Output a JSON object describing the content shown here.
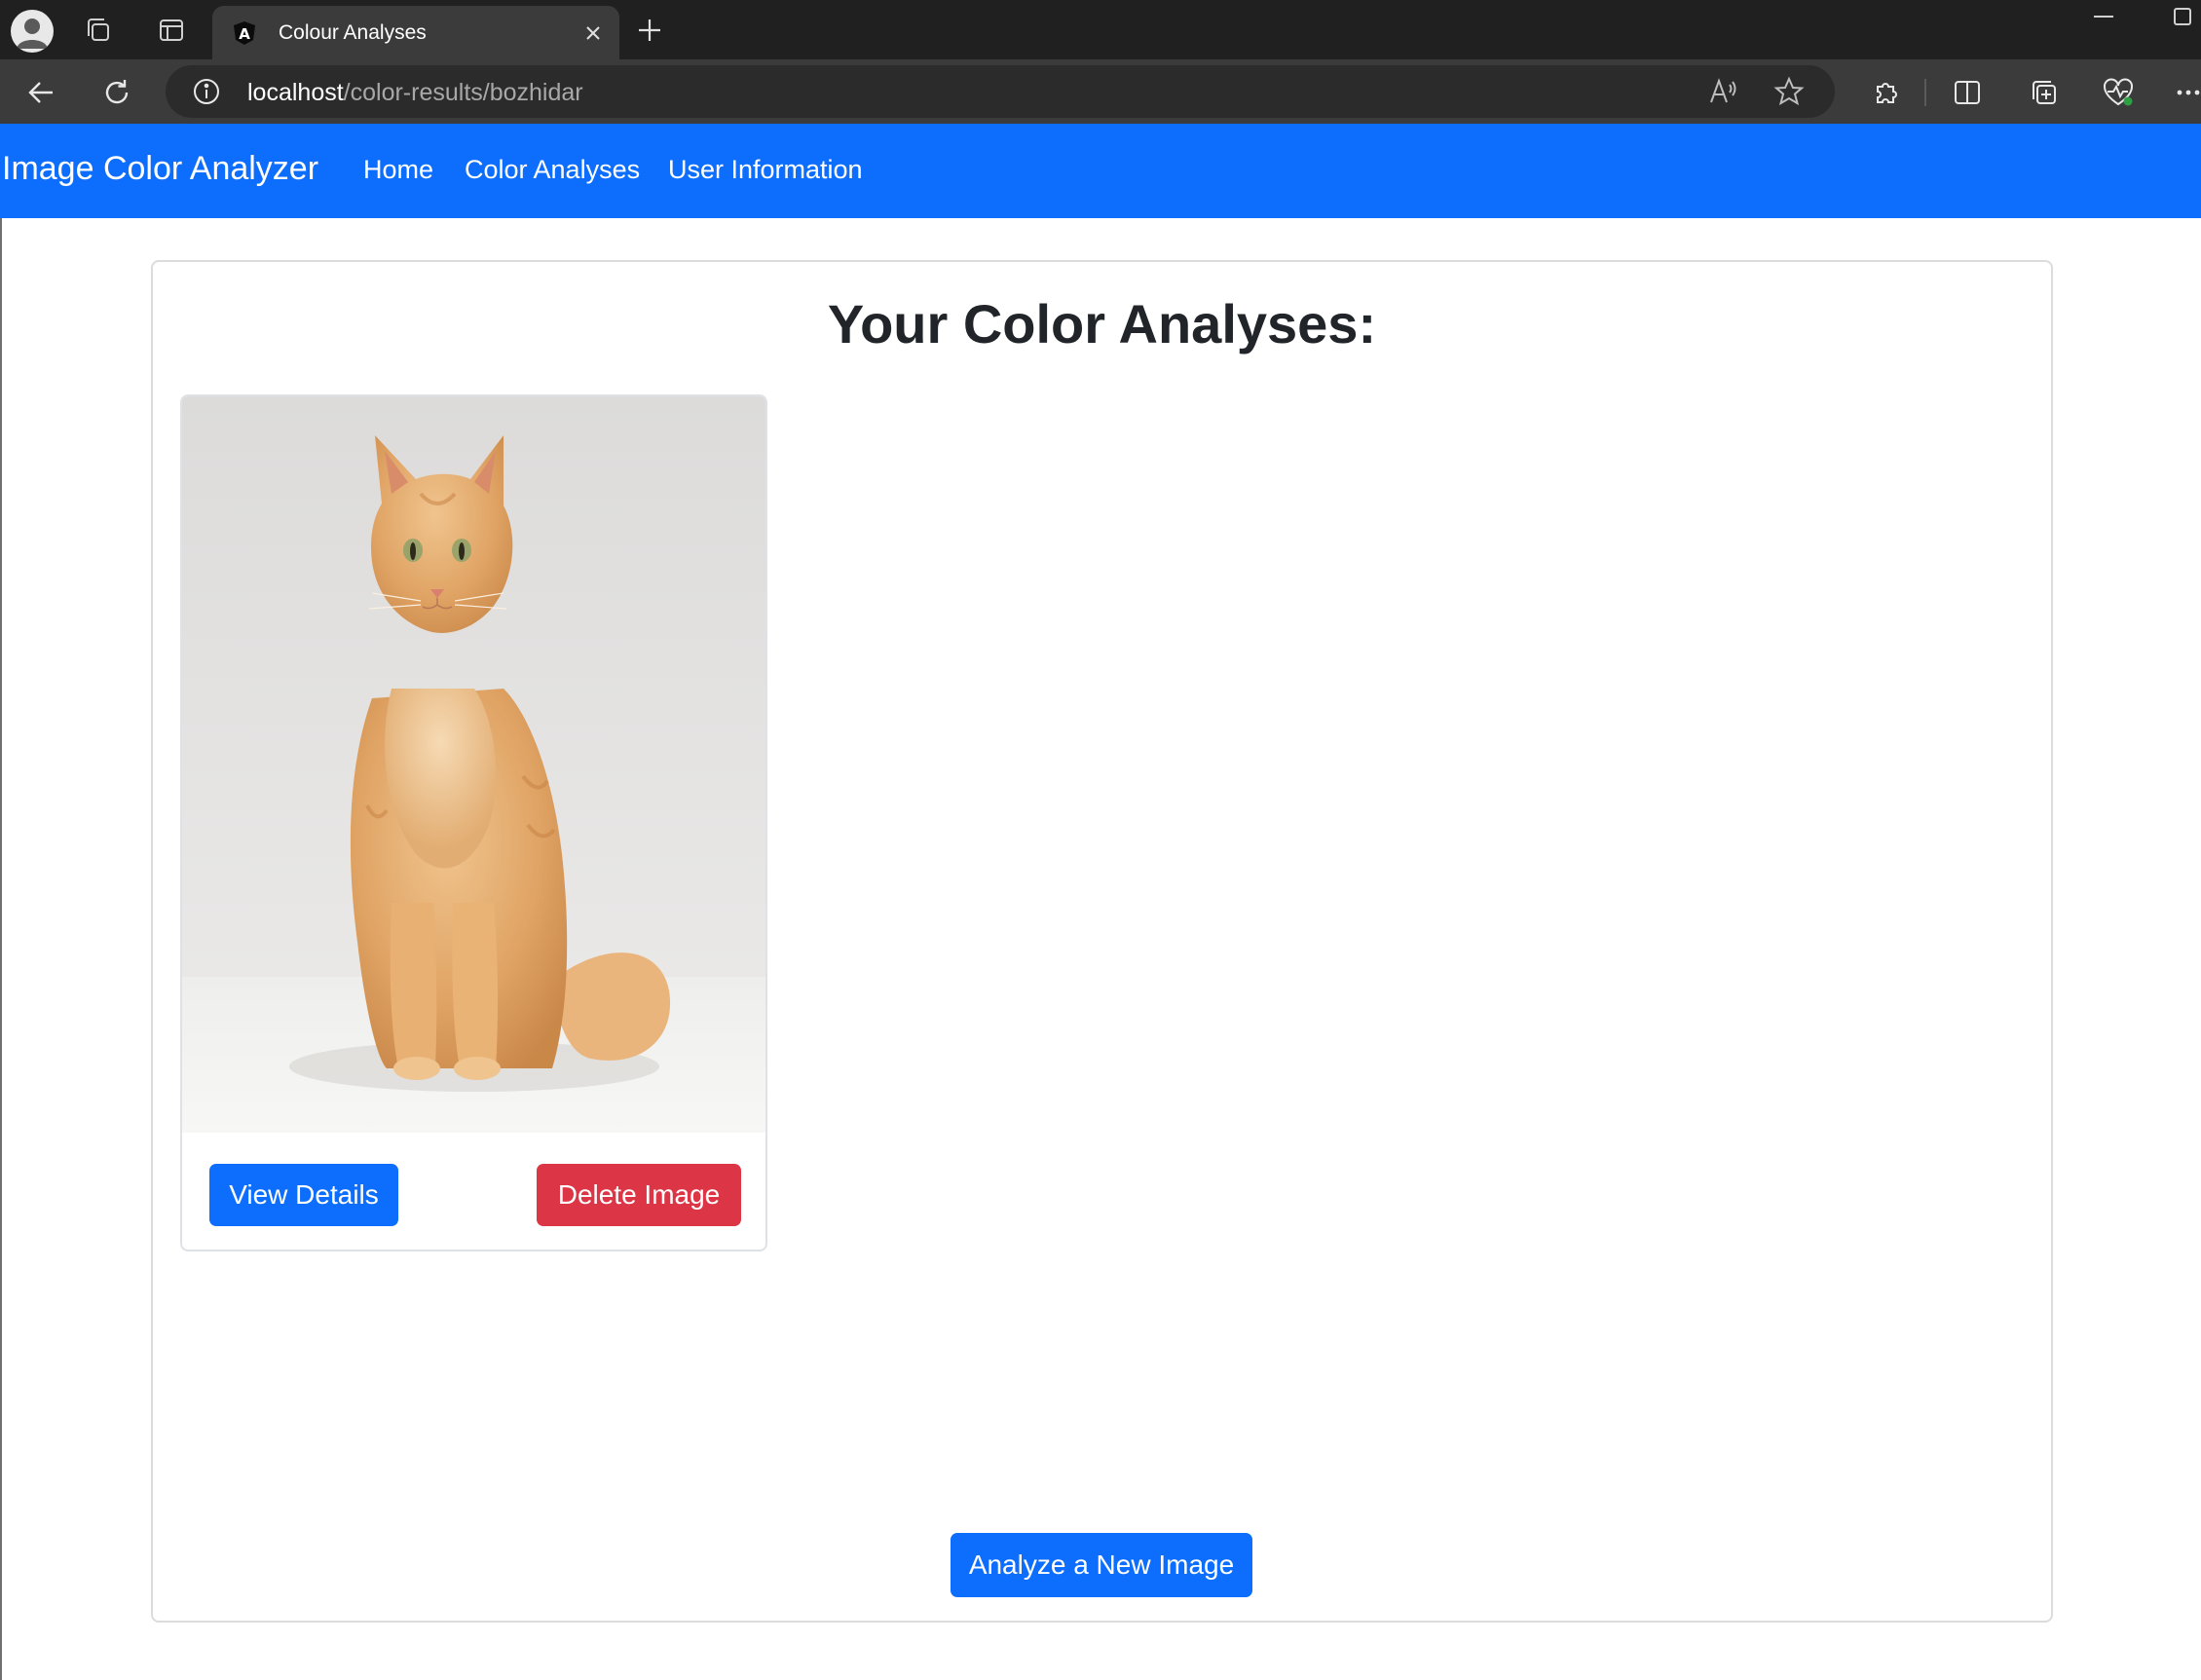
{
  "browser": {
    "tab_title": "Colour Analyses",
    "url_host": "localhost",
    "url_path": "/color-results/bozhidar",
    "icons": [
      "profile-icon",
      "workspaces-icon",
      "vertical-tabs-icon",
      "angular-favicon",
      "close-icon",
      "plus-icon",
      "minimize-icon",
      "maximize-icon",
      "back-icon",
      "refresh-icon",
      "site-info-icon",
      "read-aloud-icon",
      "favorites-star-icon",
      "extensions-icon",
      "split-screen-icon",
      "collections-icon",
      "browser-essentials-icon",
      "more-options-icon"
    ]
  },
  "navbar": {
    "brand": "Image Color Analyzer",
    "links": [
      "Home",
      "Color Analyses",
      "User Information"
    ],
    "color": "#0d6efd"
  },
  "main": {
    "title": "Your Color Analyses:",
    "cards": [
      {
        "image_subject": "orange cat photo",
        "view_label": "View Details",
        "delete_label": "Delete Image"
      }
    ],
    "analyze_label": "Analyze a New Image"
  },
  "colors": {
    "primary": "#0d6efd",
    "danger": "#dc3545",
    "chrome_dark": "#202020",
    "toolbar": "#3b3b3b"
  }
}
